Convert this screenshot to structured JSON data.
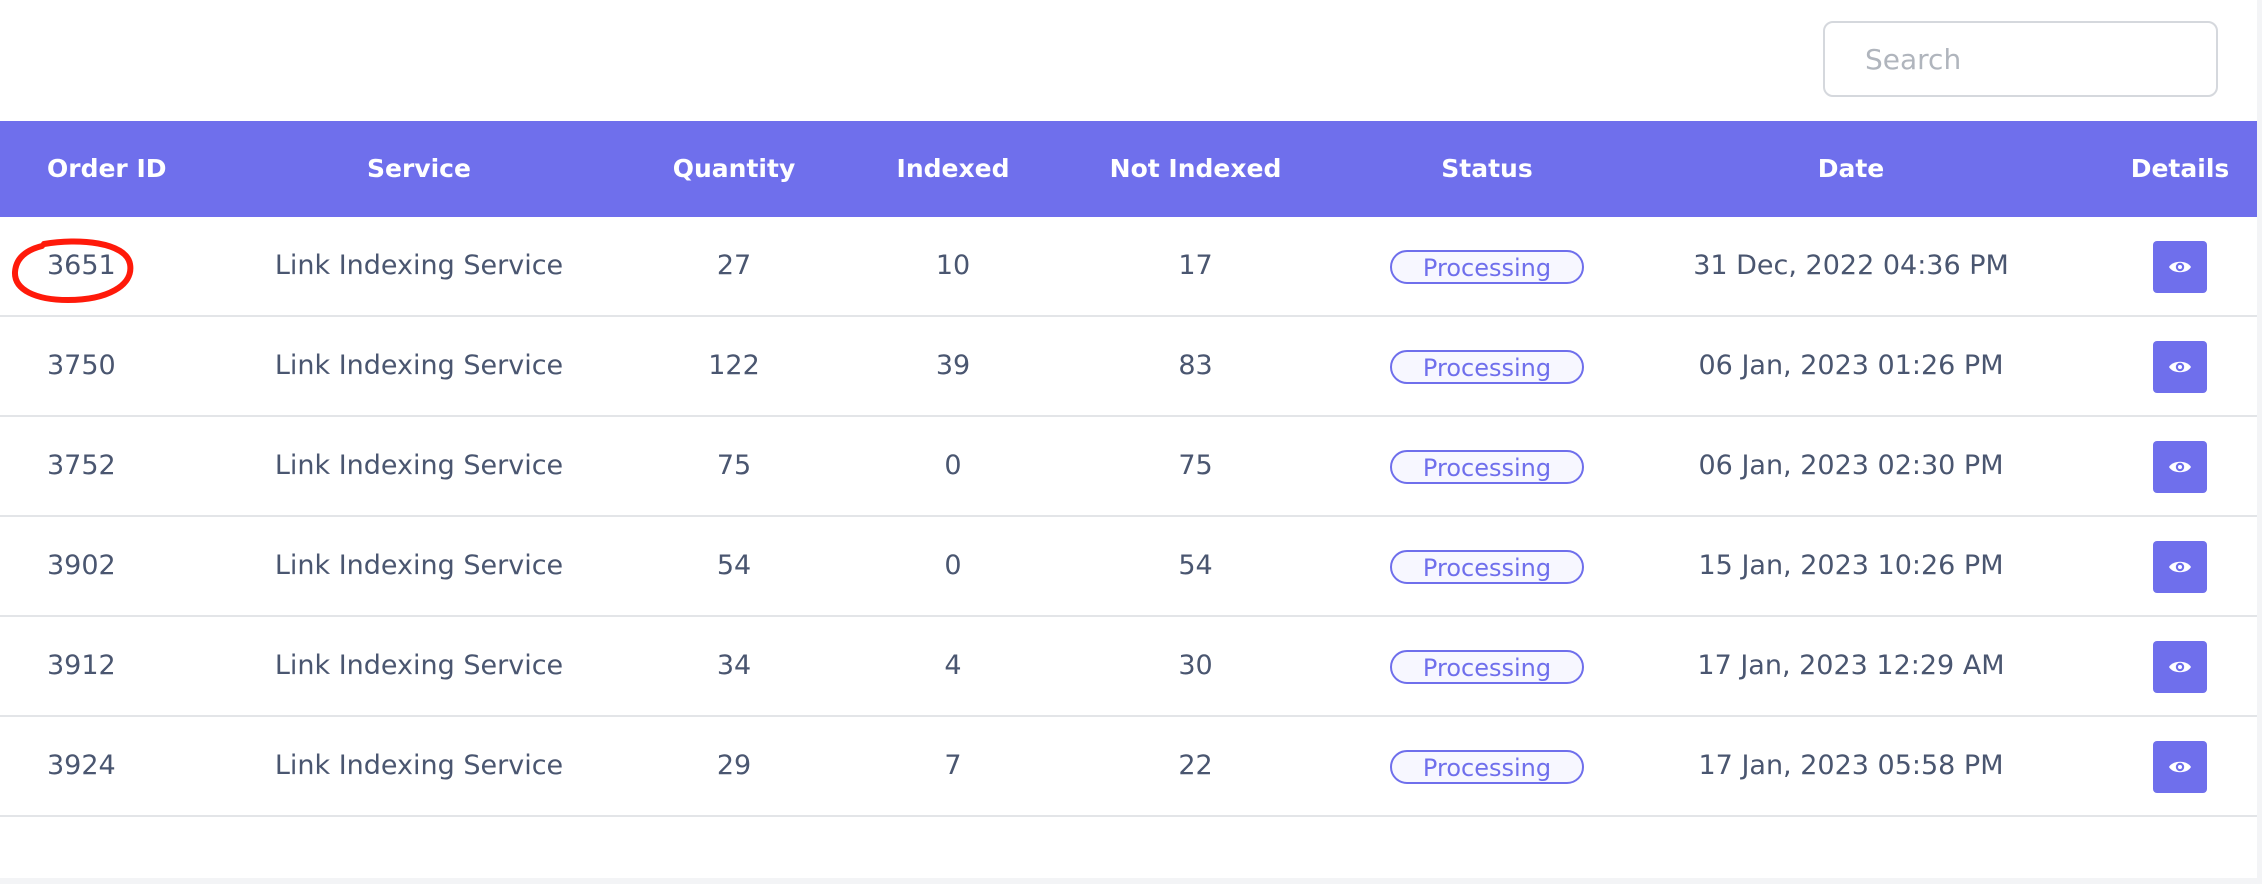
{
  "search": {
    "placeholder": "Search"
  },
  "table": {
    "columns": {
      "order_id": "Order ID",
      "service": "Service",
      "quantity": "Quantity",
      "indexed": "Indexed",
      "not_indexed": "Not Indexed",
      "status": "Status",
      "date": "Date",
      "details": "Details"
    },
    "rows": [
      {
        "order_id": "3651",
        "service": "Link Indexing Service",
        "quantity": "27",
        "indexed": "10",
        "not_indexed": "17",
        "status": "Processing",
        "date": "31 Dec, 2022 04:36 PM"
      },
      {
        "order_id": "3750",
        "service": "Link Indexing Service",
        "quantity": "122",
        "indexed": "39",
        "not_indexed": "83",
        "status": "Processing",
        "date": "06 Jan, 2023 01:26 PM"
      },
      {
        "order_id": "3752",
        "service": "Link Indexing Service",
        "quantity": "75",
        "indexed": "0",
        "not_indexed": "75",
        "status": "Processing",
        "date": "06 Jan, 2023 02:30 PM"
      },
      {
        "order_id": "3902",
        "service": "Link Indexing Service",
        "quantity": "54",
        "indexed": "0",
        "not_indexed": "54",
        "status": "Processing",
        "date": "15 Jan, 2023 10:26 PM"
      },
      {
        "order_id": "3912",
        "service": "Link Indexing Service",
        "quantity": "34",
        "indexed": "4",
        "not_indexed": "30",
        "status": "Processing",
        "date": "17 Jan, 2023 12:29 AM"
      },
      {
        "order_id": "3924",
        "service": "Link Indexing Service",
        "quantity": "29",
        "indexed": "7",
        "not_indexed": "22",
        "status": "Processing",
        "date": "17 Jan, 2023 05:58 PM"
      }
    ]
  },
  "icons": {
    "details": "eye-icon"
  },
  "colors": {
    "accent": "#6f6fec",
    "annotation": "#ff1a0a"
  }
}
